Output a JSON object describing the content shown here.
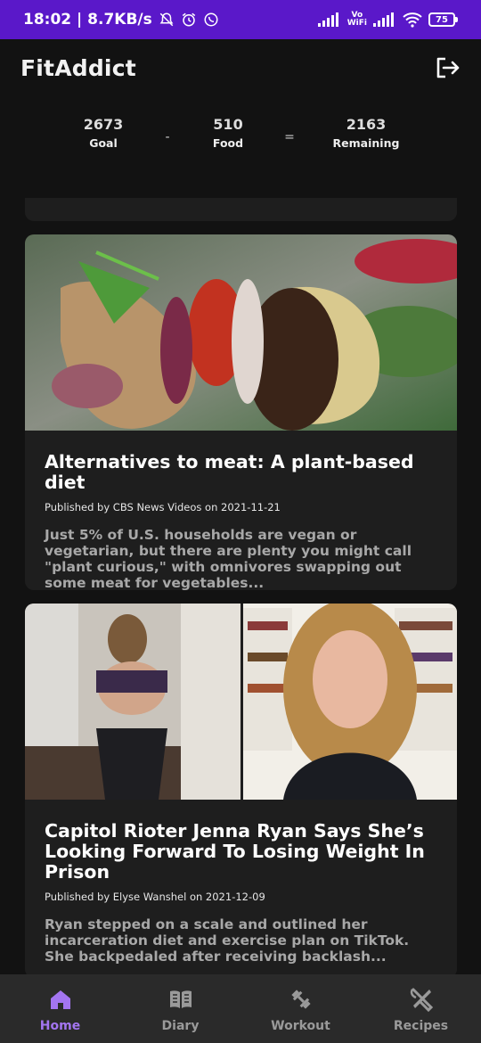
{
  "status_bar": {
    "time_speed": "18:02 | 8.7KB/s",
    "wifi_label_top": "Vo",
    "wifi_label_bottom": "WiFi",
    "battery": "75"
  },
  "app": {
    "title": "FitAddict"
  },
  "summary": {
    "goal_value": "2673",
    "goal_label": "Goal",
    "minus": "-",
    "food_value": "510",
    "food_label": "Food",
    "equals": "=",
    "remaining_value": "2163",
    "remaining_label": "Remaining"
  },
  "articles": [
    {
      "title": "Alternatives to meat: A plant-based diet",
      "meta": "Published by CBS News Videos on 2021-11-21",
      "description": "Just 5% of U.S. households are vegan or vegetarian, but there are plenty you might call \"plant curious,\" with omnivores swapping out some meat for vegetables..."
    },
    {
      "title": "Capitol Rioter Jenna Ryan Says She’s Looking Forward To Losing Weight In Prison",
      "meta": "Published by Elyse Wanshel on 2021-12-09",
      "description": "Ryan stepped on a scale and outlined her incarceration diet and exercise plan on TikTok. She backpedaled after receiving backlash..."
    }
  ],
  "nav": {
    "items": [
      {
        "label": "Home",
        "icon": "home-icon",
        "active": true
      },
      {
        "label": "Diary",
        "icon": "book-icon",
        "active": false
      },
      {
        "label": "Workout",
        "icon": "dumbbell-icon",
        "active": false
      },
      {
        "label": "Recipes",
        "icon": "utensils-icon",
        "active": false
      }
    ]
  },
  "colors": {
    "status_bar": "#5a18c9",
    "background": "#121212",
    "card": "#1e1e1e",
    "nav_bar": "#2a2a2a",
    "accent": "#a375f0"
  }
}
